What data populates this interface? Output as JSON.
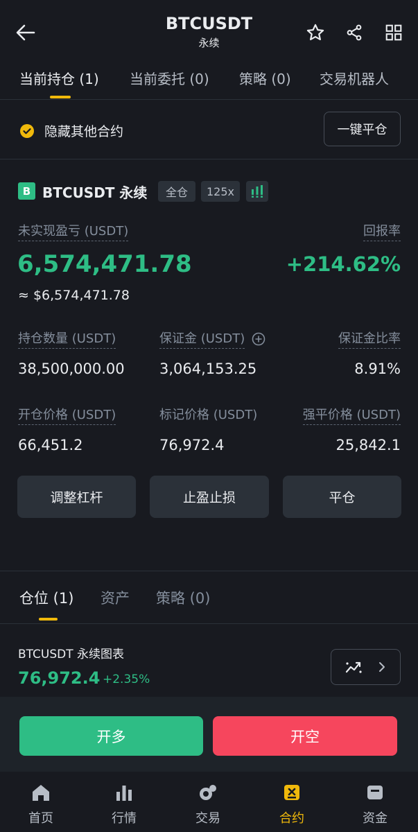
{
  "header": {
    "symbol": "BTCUSDT",
    "subtitle": "永续"
  },
  "tabs": [
    "当前持仓 (1)",
    "当前委托 (0)",
    "策略 (0)",
    "交易机器人"
  ],
  "filter": {
    "hide_label": "隐藏其他合约",
    "close_all": "一键平仓"
  },
  "position": {
    "badge": "B",
    "name": "BTCUSDT 永续",
    "margin_mode": "全仓",
    "leverage": "125x",
    "pnl_label": "未实现盈亏 (USDT)",
    "roe_label": "回报率",
    "pnl_value": "6,574,471.78",
    "roe_value": "+214.62%",
    "pnl_usd": "≈ $6,574,471.78",
    "size_label": "持仓数量 (USDT)",
    "margin_label": "保证金 (USDT)",
    "margin_ratio_label": "保证金比率",
    "size_value": "38,500,000.00",
    "margin_value": "3,064,153.25",
    "margin_ratio_value": "8.91%",
    "entry_label": "开仓价格 (USDT)",
    "mark_label": "标记价格 (USDT)",
    "liq_label": "强平价格 (USDT)",
    "entry_value": "66,451.2",
    "mark_value": "76,972.4",
    "liq_value": "25,842.1",
    "btn_leverage": "调整杠杆",
    "btn_tpsl": "止盈止损",
    "btn_close": "平仓"
  },
  "subtabs": [
    "仓位 (1)",
    "资产",
    "策略 (0)"
  ],
  "chart_row": {
    "title": "BTCUSDT 永续图表",
    "price": "76,972.4",
    "change": "+2.35%"
  },
  "actions": {
    "long": "开多",
    "short": "开空"
  },
  "nav": [
    "首页",
    "行情",
    "交易",
    "合约",
    "资金"
  ],
  "colors": {
    "accent": "#f0b90b",
    "green": "#2ebd85",
    "red": "#f6465d",
    "bg": "#181a20"
  }
}
